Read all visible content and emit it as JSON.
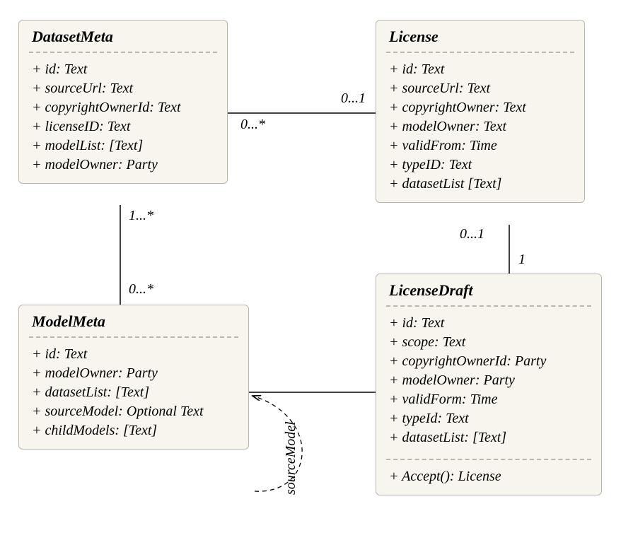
{
  "classes": {
    "datasetMeta": {
      "name": "DatasetMeta",
      "attributes": [
        "+ id: Text",
        "+ sourceUrl: Text",
        "+ copyrightOwnerId: Text",
        "+ licenseID: Text",
        "+ modelList: [Text]",
        "+ modelOwner: Party"
      ]
    },
    "license": {
      "name": "License",
      "attributes": [
        "+ id: Text",
        "+ sourceUrl: Text",
        "+ copyrightOwner: Text",
        "+ modelOwner: Text",
        "+ validFrom: Time",
        "+ typeID: Text",
        "+ datasetList [Text]"
      ]
    },
    "modelMeta": {
      "name": "ModelMeta",
      "attributes": [
        "+ id: Text",
        "+ modelOwner: Party",
        "+ datasetList: [Text]",
        "+ sourceModel: Optional Text",
        "+ childModels: [Text]"
      ]
    },
    "licenseDraft": {
      "name": "LicenseDraft",
      "attributes": [
        "+ id: Text",
        "+ scope: Text",
        "+ copyrightOwnerId: Party",
        "+ modelOwner: Party",
        "+ validForm: Time",
        "+ typeId: Text",
        "+ datasetList: [Text]"
      ],
      "operations": [
        "+ Accept(): License"
      ]
    }
  },
  "associations": {
    "dm_license": {
      "end1": "0...*",
      "end2": "0...1"
    },
    "dm_model": {
      "end1": "1...*",
      "end2": "0...*"
    },
    "license_draft": {
      "end1": "0...1",
      "end2": "1"
    },
    "model_draft": {
      "end1": "",
      "end2": ""
    },
    "model_self": {
      "label": "sourceModel"
    }
  },
  "chart_data": {
    "type": "uml_class_diagram",
    "classes": [
      {
        "name": "DatasetMeta",
        "attributes": [
          "id: Text",
          "sourceUrl: Text",
          "copyrightOwnerId: Text",
          "licenseID: Text",
          "modelList: [Text]",
          "modelOwner: Party"
        ],
        "operations": []
      },
      {
        "name": "License",
        "attributes": [
          "id: Text",
          "sourceUrl: Text",
          "copyrightOwner: Text",
          "modelOwner: Text",
          "validFrom: Time",
          "typeID: Text",
          "datasetList [Text]"
        ],
        "operations": []
      },
      {
        "name": "ModelMeta",
        "attributes": [
          "id: Text",
          "modelOwner: Party",
          "datasetList: [Text]",
          "sourceModel: Optional Text",
          "childModels: [Text]"
        ],
        "operations": []
      },
      {
        "name": "LicenseDraft",
        "attributes": [
          "id: Text",
          "scope: Text",
          "copyrightOwnerId: Party",
          "modelOwner: Party",
          "validForm: Time",
          "typeId: Text",
          "datasetList: [Text]"
        ],
        "operations": [
          "Accept(): License"
        ]
      }
    ],
    "associations": [
      {
        "from": "DatasetMeta",
        "to": "License",
        "from_mult": "0...*",
        "to_mult": "0...1"
      },
      {
        "from": "DatasetMeta",
        "to": "ModelMeta",
        "from_mult": "1...*",
        "to_mult": "0...*"
      },
      {
        "from": "License",
        "to": "LicenseDraft",
        "from_mult": "0...1",
        "to_mult": "1"
      },
      {
        "from": "ModelMeta",
        "to": "LicenseDraft",
        "from_mult": "",
        "to_mult": ""
      },
      {
        "from": "ModelMeta",
        "to": "ModelMeta",
        "label": "sourceModel",
        "style": "dashed-arrow"
      }
    ]
  }
}
